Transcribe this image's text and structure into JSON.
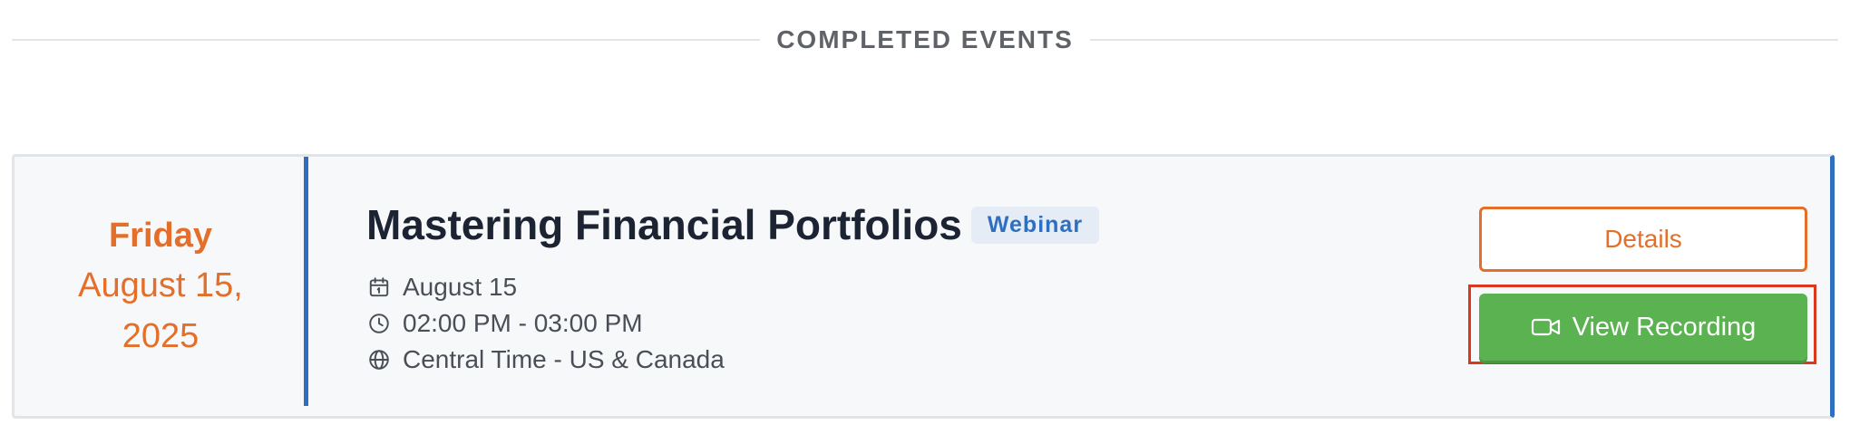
{
  "section": {
    "title": "COMPLETED EVENTS"
  },
  "event": {
    "weekday": "Friday",
    "date_full": "August 15, 2025",
    "title": "Mastering Financial Portfolios",
    "type_badge": "Webinar",
    "meta": {
      "date": "August 15",
      "time": "02:00 PM - 03:00 PM",
      "timezone": "Central Time - US & Canada"
    },
    "actions": {
      "details_label": "Details",
      "recording_label": "View Recording"
    }
  },
  "colors": {
    "accent_orange": "#e46f2a",
    "accent_blue": "#2f6fbf",
    "button_green": "#5bb251",
    "highlight_red": "#d9381e"
  },
  "icons": {
    "date": "calendar-icon",
    "time": "clock-icon",
    "timezone": "globe-icon",
    "recording": "video-camera-icon"
  }
}
